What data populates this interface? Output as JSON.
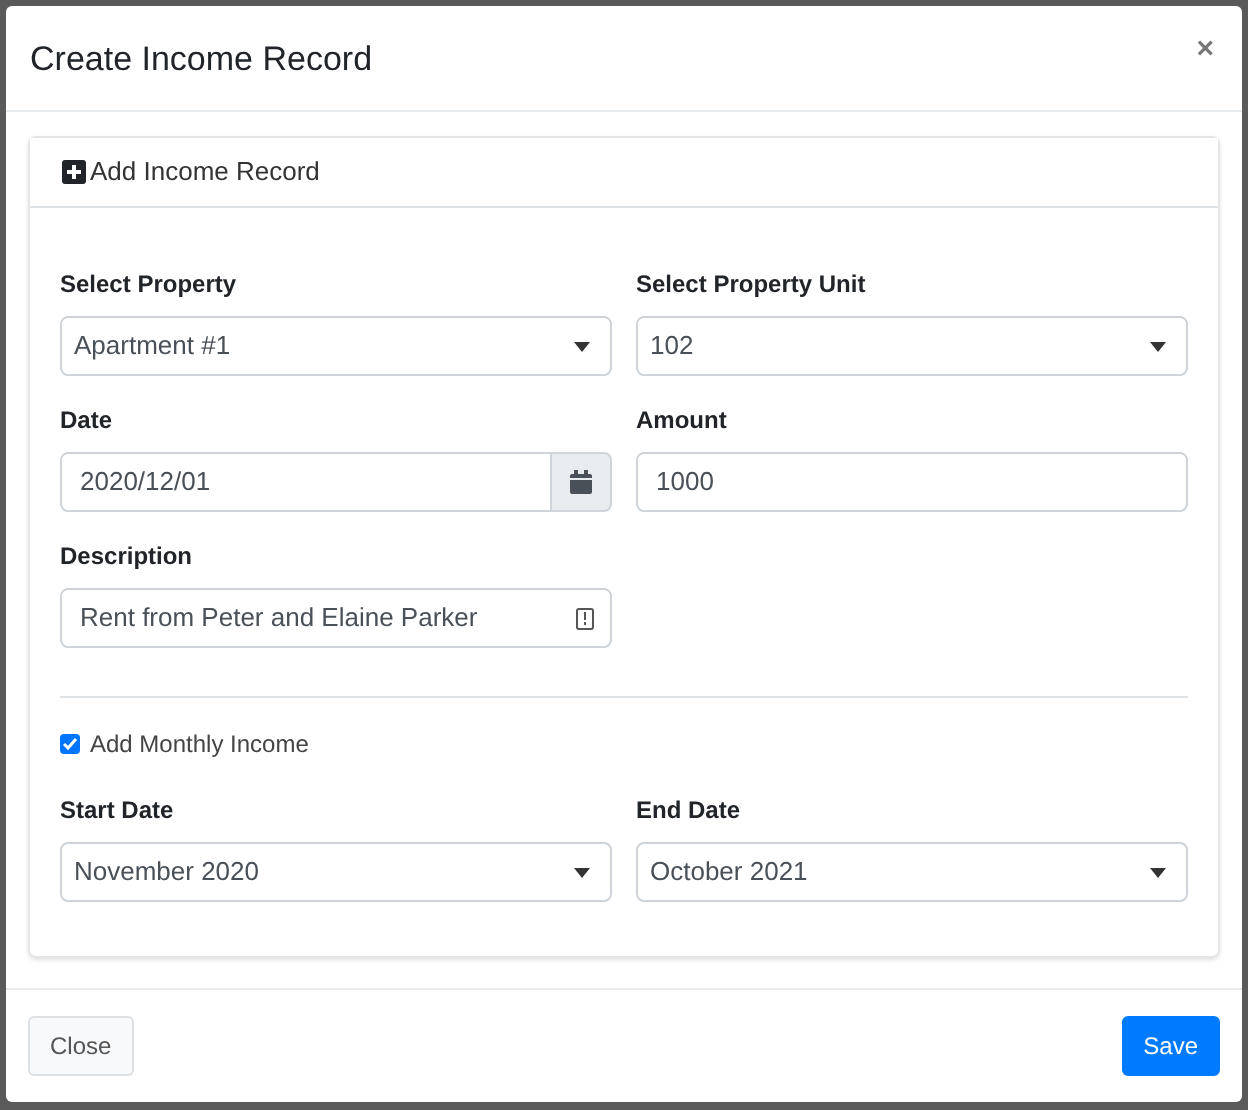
{
  "modal": {
    "title": "Create Income Record",
    "close": "×"
  },
  "card": {
    "title": "Add Income Record"
  },
  "fields": [
    {
      "label": "Select Property",
      "value": "Apartment #1",
      "kind": "select"
    },
    {
      "label": "Select Property Unit",
      "value": "102",
      "kind": "select"
    },
    {
      "label": "Date",
      "value": "2020/12/01",
      "kind": "date"
    },
    {
      "label": "Amount",
      "value": "1000",
      "kind": "text"
    },
    {
      "label": "Description",
      "value": "Rent from Peter and Elaine Parker",
      "kind": "autofill"
    }
  ],
  "monthly": {
    "label": "Add Monthly Income",
    "checked": true
  },
  "range_fields": [
    {
      "label": "Start Date",
      "value": "November 2020",
      "kind": "select"
    },
    {
      "label": "End Date",
      "value": "October 2021",
      "kind": "select"
    }
  ],
  "buttons": [
    {
      "label": "Close",
      "kind": "secondary"
    },
    {
      "label": "Save",
      "kind": "primary"
    }
  ]
}
